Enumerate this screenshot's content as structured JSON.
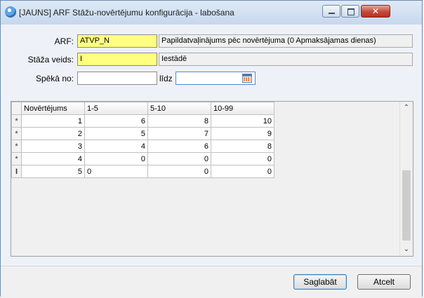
{
  "window": {
    "title": "[JAUNS] ARF Stāžu-novērtējumu konfigurācija - labošana",
    "close_glyph": "✕"
  },
  "form": {
    "arf": {
      "label": "ARF:",
      "value": "ATVP_N",
      "description": "Papildatvaļinājums pēc novērtējuma (0 Apmaksājamas dienas)"
    },
    "staza": {
      "label": "Stāža veids:",
      "value": "I",
      "description": "Iestādē"
    },
    "speka_no": {
      "label": "Spēkā no:",
      "value": ""
    },
    "lidz": {
      "label": "līdz",
      "value": ""
    }
  },
  "grid": {
    "columns": [
      "Novērtējums",
      "1-5",
      "5-10",
      "10-99"
    ],
    "rows": [
      {
        "marker": "*",
        "cells": [
          "1",
          "6",
          "8",
          "10"
        ]
      },
      {
        "marker": "*",
        "cells": [
          "2",
          "5",
          "7",
          "9"
        ]
      },
      {
        "marker": "*",
        "cells": [
          "3",
          "4",
          "6",
          "8"
        ]
      },
      {
        "marker": "*",
        "cells": [
          "4",
          "0",
          "0",
          "0"
        ]
      },
      {
        "marker": "I",
        "cells": [
          "5",
          "0",
          "0",
          "0"
        ]
      }
    ]
  },
  "buttons": {
    "save": "Saglabāt",
    "cancel": "Atcelt"
  },
  "colors": {
    "required_field": "#ffff80",
    "close_button": "#c44a3b"
  }
}
